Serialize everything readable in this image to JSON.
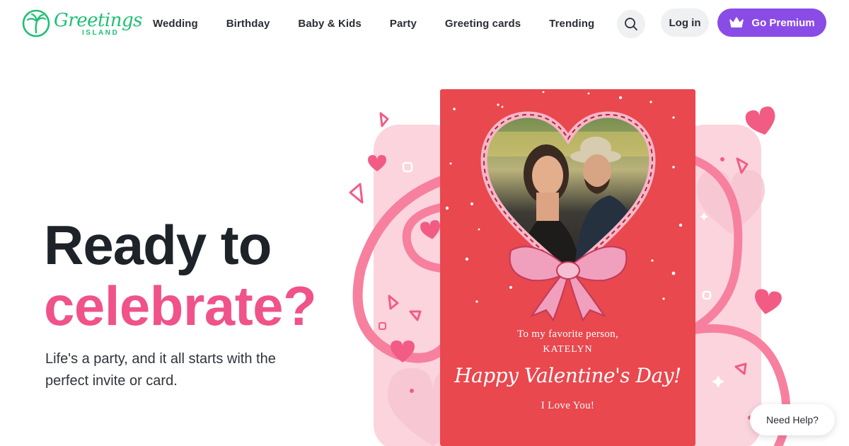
{
  "brand": {
    "logo_word": "Greetings",
    "logo_sub": "ISLAND",
    "accent": "#1fbf74"
  },
  "nav": {
    "items": [
      {
        "label": "Wedding"
      },
      {
        "label": "Birthday"
      },
      {
        "label": "Baby & Kids"
      },
      {
        "label": "Party"
      },
      {
        "label": "Greeting cards"
      },
      {
        "label": "Trending"
      }
    ],
    "search_icon": "search-icon",
    "login_label": "Log in",
    "premium_label": "Go Premium",
    "premium_icon": "crown-icon",
    "premium_color": "#8a4ce6"
  },
  "hero": {
    "title_line1": "Ready to",
    "title_line2": "celebrate?",
    "highlight_color": "#f0528a",
    "subtitle": "Life's a party, and it all starts with the perfect invite or card."
  },
  "card": {
    "line1": "To my favorite person,",
    "line2": "KATELYN",
    "script": "Happy Valentine's Day!",
    "line3": "I Love You!",
    "background": "#e8484e"
  },
  "help": {
    "label": "Need Help?"
  }
}
